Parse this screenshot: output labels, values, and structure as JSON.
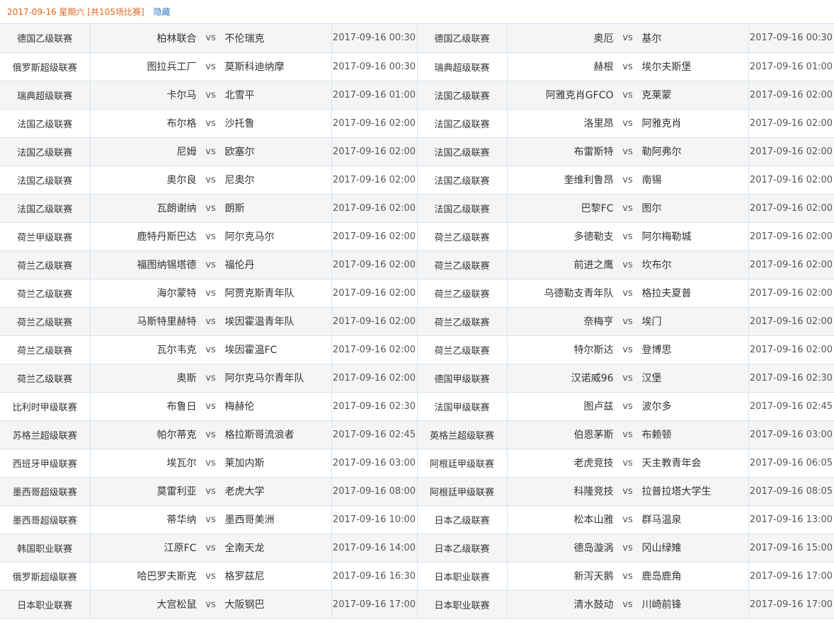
{
  "header": {
    "date_text": "2017-09-16 星期六 [共105场比赛]",
    "hide_label": "隐藏"
  },
  "vs_label": "vs",
  "rows": [
    {
      "left": {
        "league": "德国乙级联赛",
        "home": "柏林联合",
        "away": "不伦瑞克",
        "time": "2017-09-16 00:30"
      },
      "right": {
        "league": "德国乙级联赛",
        "home": "奥厄",
        "away": "基尔",
        "time": "2017-09-16 00:30"
      }
    },
    {
      "left": {
        "league": "俄罗斯超级联赛",
        "home": "图拉兵工厂",
        "away": "莫斯科迪纳摩",
        "time": "2017-09-16 00:30"
      },
      "right": {
        "league": "瑞典超级联赛",
        "home": "赫根",
        "away": "埃尔夫斯堡",
        "time": "2017-09-16 01:00"
      }
    },
    {
      "left": {
        "league": "瑞典超级联赛",
        "home": "卡尔马",
        "away": "北雪平",
        "time": "2017-09-16 01:00"
      },
      "right": {
        "league": "法国乙级联赛",
        "home": "阿雅克肖GFCO",
        "away": "克莱蒙",
        "time": "2017-09-16 02:00"
      }
    },
    {
      "left": {
        "league": "法国乙级联赛",
        "home": "布尔格",
        "away": "沙托鲁",
        "time": "2017-09-16 02:00"
      },
      "right": {
        "league": "法国乙级联赛",
        "home": "洛里昂",
        "away": "阿雅克肖",
        "time": "2017-09-16 02:00"
      }
    },
    {
      "left": {
        "league": "法国乙级联赛",
        "home": "尼姆",
        "away": "欧塞尔",
        "time": "2017-09-16 02:00"
      },
      "right": {
        "league": "法国乙级联赛",
        "home": "布雷斯特",
        "away": "勒阿弗尔",
        "time": "2017-09-16 02:00"
      }
    },
    {
      "left": {
        "league": "法国乙级联赛",
        "home": "奥尔良",
        "away": "尼奥尔",
        "time": "2017-09-16 02:00"
      },
      "right": {
        "league": "法国乙级联赛",
        "home": "奎维利鲁昂",
        "away": "南锡",
        "time": "2017-09-16 02:00"
      }
    },
    {
      "left": {
        "league": "法国乙级联赛",
        "home": "瓦朗谢纳",
        "away": "朗斯",
        "time": "2017-09-16 02:00"
      },
      "right": {
        "league": "法国乙级联赛",
        "home": "巴黎FC",
        "away": "图尔",
        "time": "2017-09-16 02:00"
      }
    },
    {
      "left": {
        "league": "荷兰甲级联赛",
        "home": "鹿特丹斯巴达",
        "away": "阿尔克马尔",
        "time": "2017-09-16 02:00"
      },
      "right": {
        "league": "荷兰乙级联赛",
        "home": "多德勒支",
        "away": "阿尔梅勒城",
        "time": "2017-09-16 02:00"
      }
    },
    {
      "left": {
        "league": "荷兰乙级联赛",
        "home": "福图纳锡塔德",
        "away": "福伦丹",
        "time": "2017-09-16 02:00"
      },
      "right": {
        "league": "荷兰乙级联赛",
        "home": "前进之鹰",
        "away": "坎布尔",
        "time": "2017-09-16 02:00"
      }
    },
    {
      "left": {
        "league": "荷兰乙级联赛",
        "home": "海尔蒙特",
        "away": "阿贾克斯青年队",
        "time": "2017-09-16 02:00"
      },
      "right": {
        "league": "荷兰乙级联赛",
        "home": "乌德勒支青年队",
        "away": "格拉夫夏普",
        "time": "2017-09-16 02:00"
      }
    },
    {
      "left": {
        "league": "荷兰乙级联赛",
        "home": "马斯特里赫特",
        "away": "埃因霍温青年队",
        "time": "2017-09-16 02:00"
      },
      "right": {
        "league": "荷兰乙级联赛",
        "home": "奈梅亨",
        "away": "埃门",
        "time": "2017-09-16 02:00"
      }
    },
    {
      "left": {
        "league": "荷兰乙级联赛",
        "home": "瓦尔韦克",
        "away": "埃因霍温FC",
        "time": "2017-09-16 02:00"
      },
      "right": {
        "league": "荷兰乙级联赛",
        "home": "特尔斯达",
        "away": "登博思",
        "time": "2017-09-16 02:00"
      }
    },
    {
      "left": {
        "league": "荷兰乙级联赛",
        "home": "奥斯",
        "away": "阿尔克马尔青年队",
        "time": "2017-09-16 02:00"
      },
      "right": {
        "league": "德国甲级联赛",
        "home": "汉诺威96",
        "away": "汉堡",
        "time": "2017-09-16 02:30"
      }
    },
    {
      "left": {
        "league": "比利时甲级联赛",
        "home": "布鲁日",
        "away": "梅赫伦",
        "time": "2017-09-16 02:30"
      },
      "right": {
        "league": "法国甲级联赛",
        "home": "图卢兹",
        "away": "波尔多",
        "time": "2017-09-16 02:45"
      }
    },
    {
      "left": {
        "league": "苏格兰超级联赛",
        "home": "帕尔蒂克",
        "away": "格拉斯哥流浪者",
        "time": "2017-09-16 02:45"
      },
      "right": {
        "league": "英格兰超级联赛",
        "home": "伯恩茅斯",
        "away": "布赖顿",
        "time": "2017-09-16 03:00"
      }
    },
    {
      "left": {
        "league": "西班牙甲级联赛",
        "home": "埃瓦尔",
        "away": "莱加内斯",
        "time": "2017-09-16 03:00"
      },
      "right": {
        "league": "阿根廷甲级联赛",
        "home": "老虎竞技",
        "away": "天主教青年会",
        "time": "2017-09-16 06:05"
      }
    },
    {
      "left": {
        "league": "墨西哥超级联赛",
        "home": "莫雷利亚",
        "away": "老虎大学",
        "time": "2017-09-16 08:00"
      },
      "right": {
        "league": "阿根廷甲级联赛",
        "home": "科隆竞技",
        "away": "拉普拉塔大学生",
        "time": "2017-09-16 08:05"
      }
    },
    {
      "left": {
        "league": "墨西哥超级联赛",
        "home": "蒂华纳",
        "away": "墨西哥美洲",
        "time": "2017-09-16 10:00"
      },
      "right": {
        "league": "日本乙级联赛",
        "home": "松本山雅",
        "away": "群马温泉",
        "time": "2017-09-16 13:00"
      }
    },
    {
      "left": {
        "league": "韩国职业联赛",
        "home": "江原FC",
        "away": "全南天龙",
        "time": "2017-09-16 14:00"
      },
      "right": {
        "league": "日本乙级联赛",
        "home": "德岛漩涡",
        "away": "冈山绿雉",
        "time": "2017-09-16 15:00"
      }
    },
    {
      "left": {
        "league": "俄罗斯超级联赛",
        "home": "哈巴罗夫斯克",
        "away": "格罗兹尼",
        "time": "2017-09-16 16:30"
      },
      "right": {
        "league": "日本职业联赛",
        "home": "新泻天鹅",
        "away": "鹿岛鹿角",
        "time": "2017-09-16 17:00"
      }
    },
    {
      "left": {
        "league": "日本职业联赛",
        "home": "大宫松鼠",
        "away": "大阪钢巴",
        "time": "2017-09-16 17:00"
      },
      "right": {
        "league": "日本职业联赛",
        "home": "清水鼓动",
        "away": "川崎前锋",
        "time": "2017-09-16 17:00"
      }
    }
  ]
}
